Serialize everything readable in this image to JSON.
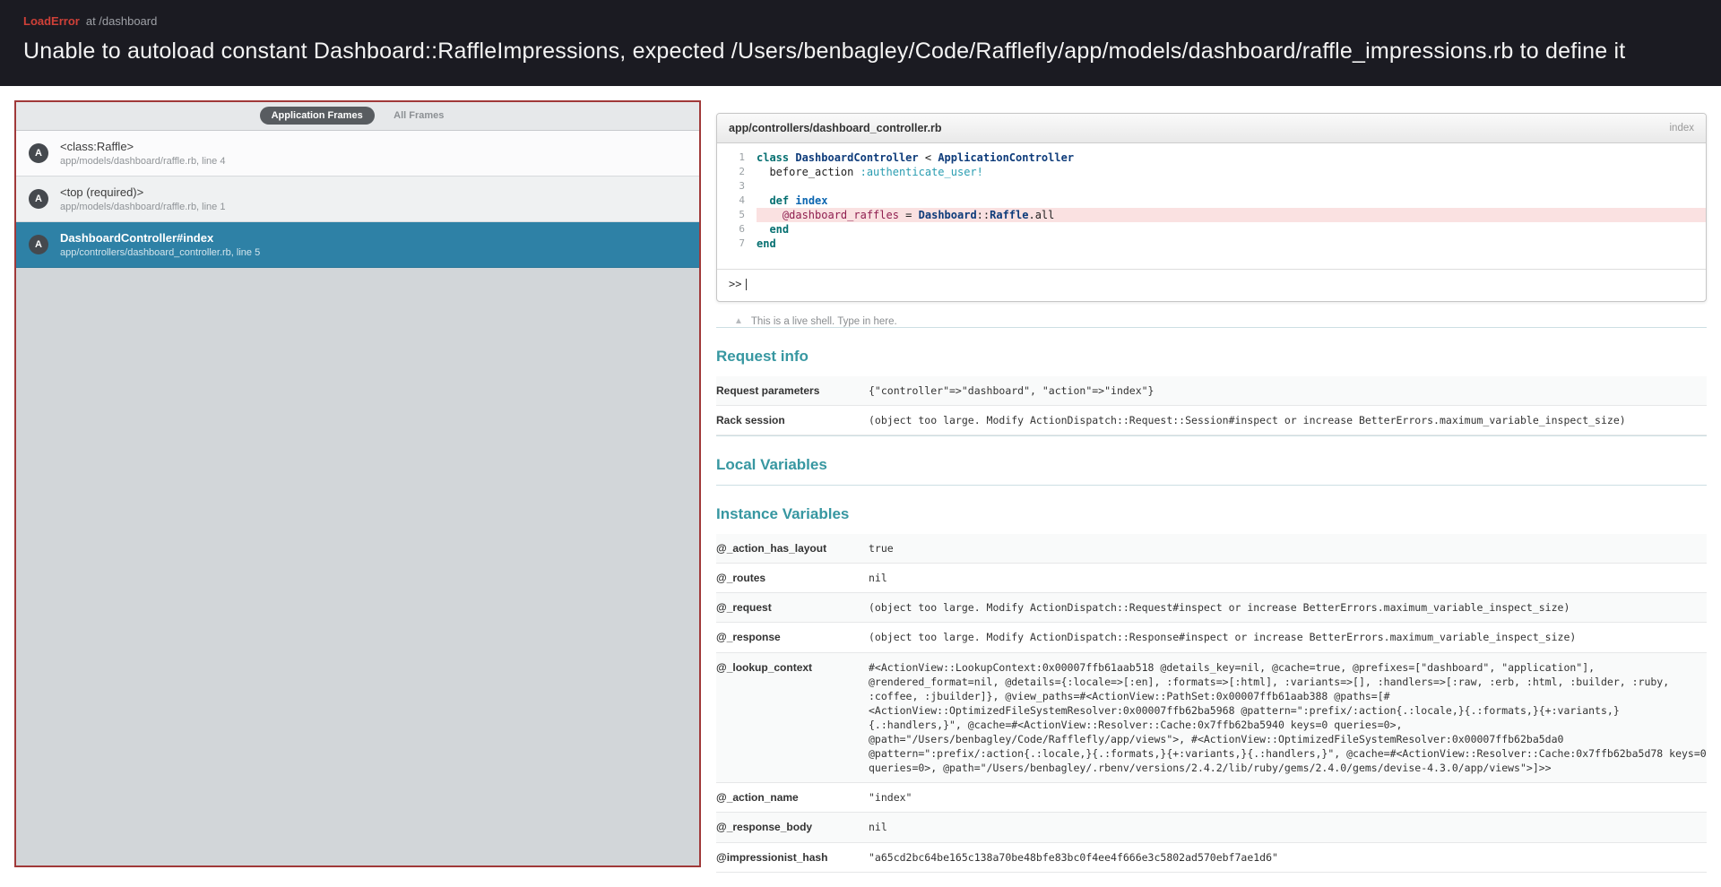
{
  "header": {
    "error_type": "LoadError",
    "at_path": "at /dashboard",
    "message": "Unable to autoload constant Dashboard::RaffleImpressions, expected /Users/benbagley/Code/Rafflefly/app/models/dashboard/raffle_impressions.rb to define it"
  },
  "sidebar": {
    "tabs": [
      {
        "label": "Application Frames",
        "active": true
      },
      {
        "label": "All Frames",
        "active": false
      }
    ],
    "frames": [
      {
        "badge": "A",
        "name": "<class:Raffle>",
        "path": "app/models/dashboard/raffle.rb, line 4",
        "selected": false
      },
      {
        "badge": "A",
        "name": "<top (required)>",
        "path": "app/models/dashboard/raffle.rb, line 1",
        "selected": false
      },
      {
        "badge": "A",
        "name": "DashboardController#index",
        "path": "app/controllers/dashboard_controller.rb, line 5",
        "selected": true
      }
    ]
  },
  "code": {
    "filename": "app/controllers/dashboard_controller.rb",
    "method": "index",
    "repl_prompt": ">>",
    "shell_note": "This is a live shell. Type in here.",
    "lines": [
      {
        "number": 1,
        "highlight": false,
        "tokens": [
          {
            "c": "k",
            "t": "class"
          },
          {
            "c": "p",
            "t": " "
          },
          {
            "c": "const",
            "t": "DashboardController"
          },
          {
            "c": "p",
            "t": " < "
          },
          {
            "c": "const",
            "t": "ApplicationController"
          }
        ]
      },
      {
        "number": 2,
        "highlight": false,
        "tokens": [
          {
            "c": "p",
            "t": "  before_action "
          },
          {
            "c": "sym",
            "t": ":authenticate_user!"
          }
        ]
      },
      {
        "number": 3,
        "highlight": false,
        "tokens": []
      },
      {
        "number": 4,
        "highlight": false,
        "tokens": [
          {
            "c": "p",
            "t": "  "
          },
          {
            "c": "k",
            "t": "def"
          },
          {
            "c": "p",
            "t": " "
          },
          {
            "c": "fn",
            "t": "index"
          }
        ]
      },
      {
        "number": 5,
        "highlight": true,
        "tokens": [
          {
            "c": "p",
            "t": "    "
          },
          {
            "c": "ivar",
            "t": "@dashboard_raffles"
          },
          {
            "c": "p",
            "t": " = "
          },
          {
            "c": "const",
            "t": "Dashboard"
          },
          {
            "c": "p",
            "t": "::"
          },
          {
            "c": "const",
            "t": "Raffle"
          },
          {
            "c": "p",
            "t": ".all"
          }
        ]
      },
      {
        "number": 6,
        "highlight": false,
        "tokens": [
          {
            "c": "p",
            "t": "  "
          },
          {
            "c": "k",
            "t": "end"
          }
        ]
      },
      {
        "number": 7,
        "highlight": false,
        "tokens": [
          {
            "c": "k",
            "t": "end"
          }
        ]
      }
    ]
  },
  "sections": {
    "request_info": {
      "title": "Request info",
      "rows": [
        {
          "label": "Request parameters",
          "value": "{\"controller\"=>\"dashboard\", \"action\"=>\"index\"}"
        },
        {
          "label": "Rack session",
          "value": "(object too large. Modify ActionDispatch::Request::Session#inspect or increase BetterErrors.maximum_variable_inspect_size)"
        }
      ]
    },
    "local_variables": {
      "title": "Local Variables",
      "rows": []
    },
    "instance_variables": {
      "title": "Instance Variables",
      "rows": [
        {
          "label": "@_action_has_layout",
          "value": "true"
        },
        {
          "label": "@_routes",
          "value": "nil"
        },
        {
          "label": "@_request",
          "value": "(object too large. Modify ActionDispatch::Request#inspect or increase BetterErrors.maximum_variable_inspect_size)"
        },
        {
          "label": "@_response",
          "value": "(object too large. Modify ActionDispatch::Response#inspect or increase BetterErrors.maximum_variable_inspect_size)"
        },
        {
          "label": "@_lookup_context",
          "value": "#<ActionView::LookupContext:0x00007ffb61aab518 @details_key=nil, @cache=true, @prefixes=[\"dashboard\", \"application\"], @rendered_format=nil, @details={:locale=>[:en], :formats=>[:html], :variants=>[], :handlers=>[:raw, :erb, :html, :builder, :ruby, :coffee, :jbuilder]}, @view_paths=#<ActionView::PathSet:0x00007ffb61aab388 @paths=[#<ActionView::OptimizedFileSystemResolver:0x00007ffb62ba5968 @pattern=\":prefix/:action{.:locale,}{.:formats,}{+:variants,}{.:handlers,}\", @cache=#<ActionView::Resolver::Cache:0x7ffb62ba5940 keys=0 queries=0>, @path=\"/Users/benbagley/Code/Rafflefly/app/views\">, #<ActionView::OptimizedFileSystemResolver:0x00007ffb62ba5da0 @pattern=\":prefix/:action{.:locale,}{.:formats,}{+:variants,}{.:handlers,}\", @cache=#<ActionView::Resolver::Cache:0x7ffb62ba5d78 keys=0 queries=0>, @path=\"/Users/benbagley/.rbenv/versions/2.4.2/lib/ruby/gems/2.4.0/gems/devise-4.3.0/app/views\">]>>"
        },
        {
          "label": "@_action_name",
          "value": "\"index\""
        },
        {
          "label": "@_response_body",
          "value": "nil"
        },
        {
          "label": "@impressionist_hash",
          "value": "\"a65cd2bc64be165c138a70be48bfe83bc0f4ee4f666e3c5802ad570ebf7ae1d6\""
        }
      ]
    }
  },
  "icons": {
    "warning": "▲"
  },
  "colors": {
    "header_bg": "#1b1b22",
    "error_red": "#cf4038",
    "panel_border_red": "#a03939",
    "panel_bg": "#d2d6d9",
    "selected_frame_blue": "#2e81a6",
    "heading_teal": "#3797a1",
    "line_highlight_pink": "#fae1e1"
  }
}
